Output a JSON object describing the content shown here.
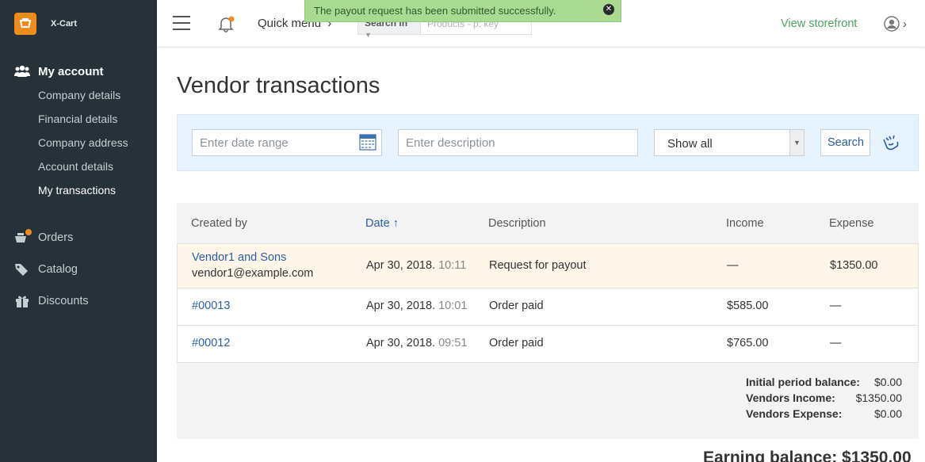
{
  "brand": {
    "name": "X-Cart"
  },
  "sidebar": {
    "my_account": "My account",
    "sub_items": [
      {
        "label": "Company details"
      },
      {
        "label": "Financial details"
      },
      {
        "label": "Company address"
      },
      {
        "label": "Account details"
      },
      {
        "label": "My transactions"
      }
    ],
    "items": [
      {
        "label": "Orders"
      },
      {
        "label": "Catalog"
      },
      {
        "label": "Discounts"
      }
    ]
  },
  "topbar": {
    "quick_menu": "Quick menu",
    "search_in": "Search in",
    "search_placeholder": "Products - p: key",
    "view_storefront": "View storefront"
  },
  "toast": {
    "message": "The payout request has been submitted successfully."
  },
  "page": {
    "title": "Vendor transactions"
  },
  "filter": {
    "date_placeholder": "Enter date range",
    "desc_placeholder": "Enter description",
    "select_value": "Show all",
    "search_label": "Search"
  },
  "table": {
    "headers": [
      "Created by",
      "Date",
      "Description",
      "Income",
      "Expense"
    ],
    "sort_arrow": "↑",
    "rows": [
      {
        "created_by": "Vendor1 and Sons",
        "email": "vendor1@example.com",
        "date": "Apr 30, 2018.",
        "time": "10:11",
        "description": "Request for payout",
        "income": "—",
        "expense": "$1350.00"
      },
      {
        "created_by": "#00013",
        "date": "Apr 30, 2018.",
        "time": "10:01",
        "description": "Order paid",
        "income": "$585.00",
        "expense": "—"
      },
      {
        "created_by": "#00012",
        "date": "Apr 30, 2018.",
        "time": "09:51",
        "description": "Order paid",
        "income": "$765.00",
        "expense": "—"
      }
    ]
  },
  "totals": {
    "initial_label": "Initial period balance:",
    "initial_value": "$0.00",
    "income_label": "Vendors Income:",
    "income_value": "$1350.00",
    "expense_label": "Vendors Expense:",
    "expense_value": "$0.00"
  },
  "earning": "Earning balance: $1350.00",
  "colors": {
    "sidebar_bg": "#273238",
    "accent_orange": "#f08c1e",
    "link_blue": "#2a5d9f",
    "storefront_green": "#4fa35c",
    "toast_green": "#a8da92"
  }
}
